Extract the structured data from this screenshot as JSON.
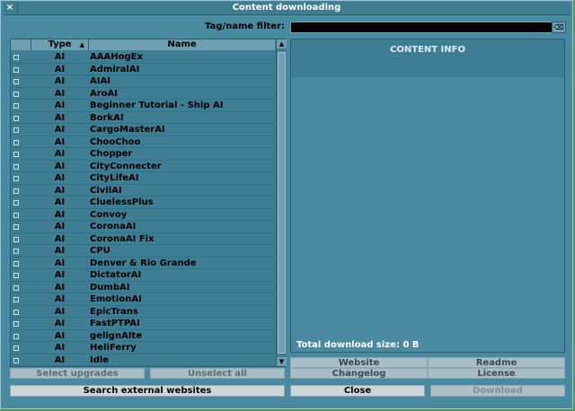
{
  "window": {
    "title": "Content downloading"
  },
  "filter": {
    "label": "Tag/name filter:",
    "value": ""
  },
  "list": {
    "headers": {
      "type": "Type",
      "name": "Name"
    },
    "rows": [
      {
        "type": "AI",
        "name": "AAAHogEx"
      },
      {
        "type": "AI",
        "name": "AdmiralAI"
      },
      {
        "type": "AI",
        "name": "AIAI"
      },
      {
        "type": "AI",
        "name": "AroAI"
      },
      {
        "type": "AI",
        "name": "Beginner Tutorial - Ship AI"
      },
      {
        "type": "AI",
        "name": "BorkAI"
      },
      {
        "type": "AI",
        "name": "CargoMasterAI"
      },
      {
        "type": "AI",
        "name": "ChooChoo"
      },
      {
        "type": "AI",
        "name": "Chopper"
      },
      {
        "type": "AI",
        "name": "CityConnecter"
      },
      {
        "type": "AI",
        "name": "CityLifeAI"
      },
      {
        "type": "AI",
        "name": "CivilAI"
      },
      {
        "type": "AI",
        "name": "CluelessPlus"
      },
      {
        "type": "AI",
        "name": "Convoy"
      },
      {
        "type": "AI",
        "name": "CoronaAI"
      },
      {
        "type": "AI",
        "name": "CoronaAI Fix"
      },
      {
        "type": "AI",
        "name": "CPU"
      },
      {
        "type": "AI",
        "name": "Denver & Rio Grande"
      },
      {
        "type": "AI",
        "name": "DictatorAI"
      },
      {
        "type": "AI",
        "name": "DumbAI"
      },
      {
        "type": "AI",
        "name": "EmotionAI"
      },
      {
        "type": "AI",
        "name": "EpicTrans"
      },
      {
        "type": "AI",
        "name": "FastPTPAI"
      },
      {
        "type": "AI",
        "name": "gelignAIte"
      },
      {
        "type": "AI",
        "name": "HeliFerry"
      },
      {
        "type": "AI",
        "name": "Idle"
      }
    ]
  },
  "info": {
    "heading": "CONTENT INFO",
    "total_label": "Total download size:",
    "total_value": "0 B"
  },
  "buttons": {
    "select_upgrades": "Select upgrades",
    "unselect_all": "Unselect all",
    "website": "Website",
    "readme": "Readme",
    "changelog": "Changelog",
    "license": "License",
    "search_external": "Search external websites",
    "close": "Close",
    "download": "Download"
  }
}
